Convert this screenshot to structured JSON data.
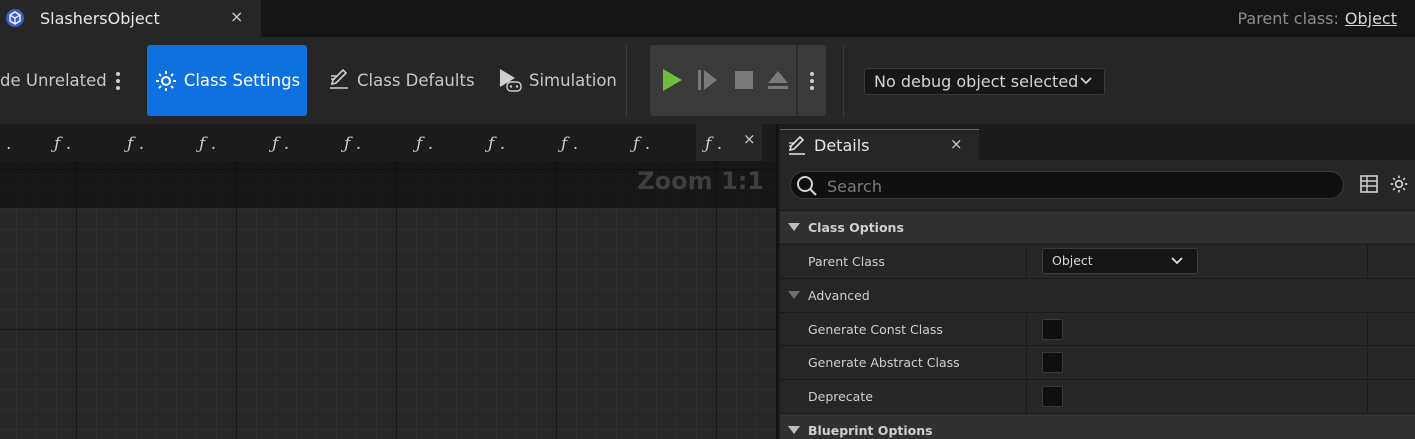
{
  "window": {
    "doc_title": "SlashersObject",
    "close_glyph": "×",
    "parent_class_label": "Parent class:",
    "parent_class_value": "Object"
  },
  "toolbar": {
    "hide_unrelated_label": "de Unrelated",
    "class_settings_label": "Class Settings",
    "class_defaults_label": "Class Defaults",
    "simulation_label": "Simulation",
    "debug_object_label": "No debug object selected",
    "accent_color": "#0f70e0",
    "play_color": "#6fbf3a"
  },
  "graph": {
    "function_tabs": [
      "ƒ .",
      "ƒ .",
      "ƒ .",
      "ƒ .",
      "ƒ .",
      "ƒ .",
      "ƒ .",
      "ƒ .",
      "ƒ .",
      "ƒ ."
    ],
    "first_tab": ".",
    "active_tab_close": "×",
    "zoom_label": "Zoom 1:1"
  },
  "details": {
    "tab_title": "Details",
    "tab_close": "×",
    "search_placeholder": "Search",
    "categories": {
      "class_options": "Class Options",
      "advanced": "Advanced",
      "blueprint_options": "Blueprint Options"
    },
    "properties": {
      "parent_class_label": "Parent Class",
      "parent_class_value": "Object",
      "generate_const_label": "Generate Const Class",
      "generate_const_checked": false,
      "generate_abstract_label": "Generate Abstract Class",
      "generate_abstract_checked": false,
      "deprecate_label": "Deprecate",
      "deprecate_checked": false
    }
  }
}
